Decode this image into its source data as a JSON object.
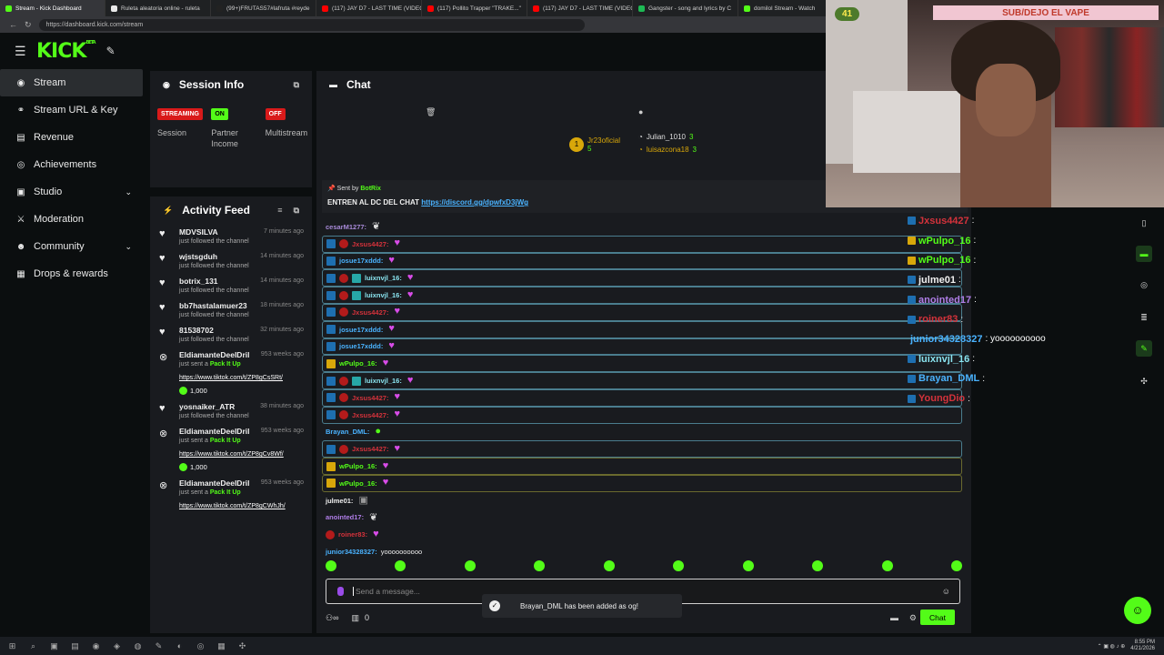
{
  "browser": {
    "tabs": [
      {
        "label": "Stream - Kick Dashboard",
        "color": "#53fc18"
      },
      {
        "label": "Ruleta aleatoria online - ruleta",
        "color": "#e9e9e9"
      },
      {
        "label": "(99+)FRUTAS57#lafruta #reyde",
        "color": "#222"
      },
      {
        "label": "(117) JAY D7 - LAST TIME (VIDEO",
        "color": "#ff0000"
      },
      {
        "label": "(117) Pollito Trapper \"TRAKE...\"",
        "color": "#ff0000"
      },
      {
        "label": "(117) JAY D7 - LAST TIME (VIDEO",
        "color": "#ff0000"
      },
      {
        "label": "Gangster - song and lyrics by C",
        "color": "#1db954"
      },
      {
        "label": "domilol Stream - Watch",
        "color": "#53fc18"
      }
    ],
    "url": "https://dashboard.kick.com/stream"
  },
  "topbar": {
    "logo": "KICK",
    "logo_sup": "BETA"
  },
  "sidebar": {
    "items": [
      {
        "label": "Stream",
        "icon": "broadcast-icon",
        "glyph": "◉"
      },
      {
        "label": "Stream URL & Key",
        "icon": "link-icon",
        "glyph": "⚭"
      },
      {
        "label": "Revenue",
        "icon": "revenue-icon",
        "glyph": "▤"
      },
      {
        "label": "Achievements",
        "icon": "achievement-icon",
        "glyph": "◎"
      },
      {
        "label": "Studio",
        "icon": "studio-icon",
        "glyph": "▣"
      },
      {
        "label": "Moderation",
        "icon": "sword-icon",
        "glyph": "⚔"
      },
      {
        "label": "Community",
        "icon": "community-icon",
        "glyph": "☻"
      },
      {
        "label": "Drops & rewards",
        "icon": "gift-icon",
        "glyph": "▦"
      }
    ]
  },
  "session": {
    "title": "Session Info",
    "stats": [
      {
        "badge": "STREAMING",
        "label": "Session",
        "style": "red"
      },
      {
        "badge": "ON",
        "label": "Partner Income",
        "style": "green"
      },
      {
        "badge": "OFF",
        "label": "Multistream",
        "style": "red"
      }
    ]
  },
  "activity": {
    "title": "Activity Feed",
    "items": [
      {
        "name": "MDVSILVA",
        "time": "7 minutes ago",
        "desc": "just followed the channel",
        "type": "follow"
      },
      {
        "name": "wjstsgduh",
        "time": "14 minutes ago",
        "desc": "just followed the channel",
        "type": "follow"
      },
      {
        "name": "botrix_131",
        "time": "14 minutes ago",
        "desc": "just followed the channel",
        "type": "follow"
      },
      {
        "name": "bb7hastalamuer23",
        "time": "18 minutes ago",
        "desc": "just followed the channel",
        "type": "follow"
      },
      {
        "name": "81538702",
        "time": "32 minutes ago",
        "desc": "just followed the channel",
        "type": "follow"
      },
      {
        "name": "EldiamanteDeelDril",
        "time": "953 weeks ago",
        "desc_pre": "just sent a ",
        "desc_b": "Pack It Up",
        "link": "https://www.tiktok.com/t/ZP8gCsSRt/",
        "amount": "1,000",
        "type": "gift"
      },
      {
        "name": "yosnaiker_ATR",
        "time": "38 minutes ago",
        "desc": "just followed the channel",
        "type": "follow"
      },
      {
        "name": "EldiamanteDeelDril",
        "time": "953 weeks ago",
        "desc_pre": "just sent a ",
        "desc_b": "Pack It Up",
        "link": "https://www.tiktok.com/t/ZP8gCv8Wf/",
        "amount": "1,000",
        "type": "gift"
      },
      {
        "name": "EldiamanteDeelDril",
        "time": "953 weeks ago",
        "desc_pre": "just sent a ",
        "desc_b": "Pack It Up",
        "link": "https://www.tiktok.com/t/ZP8gCWhJh/",
        "amount": "",
        "type": "gift"
      }
    ]
  },
  "chat": {
    "title": "Chat",
    "leaders": [
      {
        "name": "Jr23oficial",
        "count": "5",
        "rank": "1"
      },
      {
        "name": "Julian_1010",
        "count": "3"
      },
      {
        "name": "luisazcona18",
        "count": "3"
      }
    ],
    "pinned": {
      "sent_by": "Sent by",
      "bot": "BotRix",
      "text": "ENTREN AL DC DEL CHAT",
      "link": "https://discord.gg/dpwfxD3jWg"
    },
    "messages": [
      {
        "user": "cesarM1277:",
        "color": "#a88ad8",
        "badges": [],
        "emote": "feather",
        "hl": ""
      },
      {
        "user": "Jxsus4427:",
        "color": "#d4323b",
        "badges": [
          "b1",
          "b2"
        ],
        "emote": "heart",
        "hl": "hl"
      },
      {
        "user": "josue17xddd:",
        "color": "#4ab3ff",
        "badges": [
          "b1"
        ],
        "emote": "heart",
        "hl": "hl"
      },
      {
        "user": "luixnvjl_16:",
        "color": "#8ae4f0",
        "badges": [
          "b1",
          "b2",
          "b4"
        ],
        "emote": "heart",
        "hl": "hl"
      },
      {
        "user": "luixnvjl_16:",
        "color": "#8ae4f0",
        "badges": [
          "b1",
          "b2",
          "b4"
        ],
        "emote": "heart",
        "hl": "hl"
      },
      {
        "user": "Jxsus4427:",
        "color": "#d4323b",
        "badges": [
          "b1",
          "b2"
        ],
        "emote": "heart",
        "hl": "hl"
      },
      {
        "user": "josue17xddd:",
        "color": "#4ab3ff",
        "badges": [
          "b1"
        ],
        "emote": "heart",
        "hl": "hl"
      },
      {
        "user": "josue17xddd:",
        "color": "#4ab3ff",
        "badges": [
          "b1"
        ],
        "emote": "heart",
        "hl": "hl"
      },
      {
        "user": "wPulpo_16:",
        "color": "#53fc18",
        "badges": [
          "b3"
        ],
        "emote": "heart",
        "hl": "hl"
      },
      {
        "user": "luixnvjl_16:",
        "color": "#8ae4f0",
        "badges": [
          "b1",
          "b2",
          "b4"
        ],
        "emote": "heart",
        "hl": "hl"
      },
      {
        "user": "Jxsus4427:",
        "color": "#d4323b",
        "badges": [
          "b1",
          "b2"
        ],
        "emote": "heart",
        "hl": "hl"
      },
      {
        "user": "Jxsus4427:",
        "color": "#d4323b",
        "badges": [
          "b1",
          "b2"
        ],
        "emote": "heart",
        "hl": "hl"
      },
      {
        "user": "Brayan_DML:",
        "color": "#4ab3ff",
        "badges": [],
        "emote": "frog",
        "hl": ""
      },
      {
        "user": "Jxsus4427:",
        "color": "#d4323b",
        "badges": [
          "b1",
          "b2"
        ],
        "emote": "heart",
        "hl": "hl"
      },
      {
        "user": "wPulpo_16:",
        "color": "#53fc18",
        "badges": [
          "b3"
        ],
        "emote": "heart",
        "hl": "hl2"
      },
      {
        "user": "wPulpo_16:",
        "color": "#53fc18",
        "badges": [
          "b3"
        ],
        "emote": "heart",
        "hl": "hl2"
      },
      {
        "user": "julme01:",
        "color": "#f0f0f0",
        "badges": [],
        "emote": "img",
        "hl": ""
      },
      {
        "user": "anointed17:",
        "color": "#b07ee8",
        "badges": [],
        "emote": "feather",
        "hl": ""
      },
      {
        "user": "roiner83:",
        "color": "#d4323b",
        "badges": [
          "b2"
        ],
        "emote": "heart",
        "hl": ""
      },
      {
        "user": "junior34328327:",
        "color": "#4ab3ff",
        "badges": [],
        "text": "yoooooooooo",
        "emote": "",
        "hl": ""
      }
    ],
    "input_placeholder": "Send a message...",
    "viewer_count": "0",
    "send_label": "Chat"
  },
  "toast": {
    "text": "Brayan_DML has been added as og!"
  },
  "stream_overlay": {
    "viewer_count": "41",
    "banner": "SUB/DEJO EL VAPE",
    "chat": [
      {
        "user": "Jxsus4427",
        "color": "#d4323b",
        "text": ":"
      },
      {
        "user": "wPulpo_16",
        "color": "#53fc18",
        "text": ":"
      },
      {
        "user": "wPulpo_16",
        "color": "#53fc18",
        "text": ":"
      },
      {
        "user": "julme01",
        "color": "#f0f0f0",
        "text": ":"
      },
      {
        "user": "anointed17",
        "color": "#b07ee8",
        "text": ":"
      },
      {
        "user": "roiner83",
        "color": "#d4323b",
        "text": ":"
      },
      {
        "user": "junior34328327",
        "color": "#4ab3ff",
        "text": ": yoooooooooo"
      },
      {
        "user": "luixnvjl_16",
        "color": "#8ae4f0",
        "text": ":"
      },
      {
        "user": "Brayan_DML",
        "color": "#4ab3ff",
        "text": ":"
      },
      {
        "user": "YoungDio",
        "color": "#d4323b",
        "text": ":"
      }
    ]
  },
  "taskbar": {
    "time": "8:55 PM",
    "date": "4/21/2026"
  },
  "colors": {
    "accent": "#53fc18",
    "panel": "#191b1f",
    "bg": "#0b0e0f"
  }
}
